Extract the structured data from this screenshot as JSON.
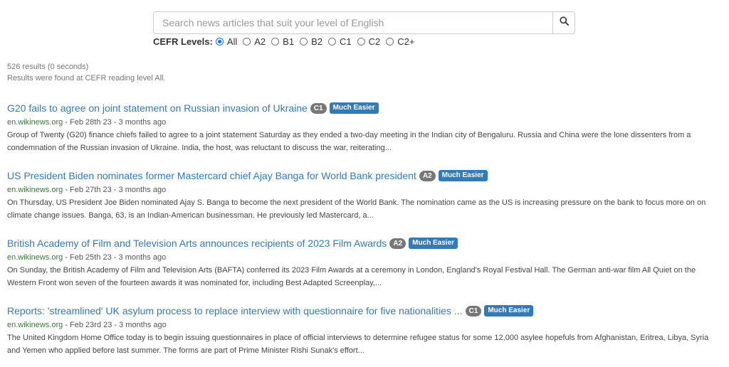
{
  "search": {
    "placeholder": "Search news articles that suit your level of English",
    "icon": "search-icon"
  },
  "cefr": {
    "label": "CEFR Levels:",
    "options": [
      {
        "label": "All",
        "checked": true
      },
      {
        "label": "A2",
        "checked": false
      },
      {
        "label": "B1",
        "checked": false
      },
      {
        "label": "B2",
        "checked": false
      },
      {
        "label": "C1",
        "checked": false
      },
      {
        "label": "C2",
        "checked": false
      },
      {
        "label": "C2+",
        "checked": false
      }
    ]
  },
  "meta": {
    "count": "526 results (0 seconds)",
    "level_note": "Results were found at CEFR reading level All."
  },
  "results": [
    {
      "title": "G20 fails to agree on joint statement on Russian invasion of Ukraine",
      "level": "C1",
      "ease": "Much Easier",
      "source": "en.wikinews.org",
      "date": " - Feb 28th 23 - 3 months ago",
      "snippet": "Group of Twenty (G20) finance chiefs failed to agree to a joint statement Saturday as they ended a two-day meeting in the Indian city of Bengaluru. Russia and China were the lone dissenters from a condemnation of the Russian invasion of Ukraine. India, the host, was reluctant to discuss the war, reiterating..."
    },
    {
      "title": "US President Biden nominates former Mastercard chief Ajay Banga for World Bank president",
      "level": "A2",
      "ease": "Much Easier",
      "source": "en.wikinews.org",
      "date": " - Feb 27th 23 - 3 months ago",
      "snippet": "On Thursday, US President Joe Biden nominated Ajay S. Banga to become the next president of the World Bank. The nomination came as the US is increasing pressure on the bank to focus more on on climate change issues. Banga, 63, is an Indian-American businessman. He previously led Mastercard, a..."
    },
    {
      "title": "British Academy of Film and Television Arts announces recipients of 2023 Film Awards",
      "level": "A2",
      "ease": "Much Easier",
      "source": "en.wikinews.org",
      "date": " - Feb 25th 23 - 3 months ago",
      "snippet": "On Sunday, the British Academy of Film and Television Arts (BAFTA) conferred its 2023 Film Awards at a ceremony in London, England's Royal Festival Hall. The German anti-war film All Quiet on the Western Front won seven of the fourteen awards it was nominated for, including Best Adapted Screenplay,..."
    },
    {
      "title": "Reports: 'streamlined' UK asylum process to replace interview with questionnaire for five nationalities ...",
      "level": "C1",
      "ease": "Much Easier",
      "source": "en.wikinews.org",
      "date": " - Feb 23rd 23 - 3 months ago",
      "snippet": "The United Kingdom Home Office today is to begin issuing questionnaires in place of official interviews to determine refugee status for some 12,000 asylee hopefuls from Afghanistan, Eritrea, Libya, Syria and Yemen who applied before last summer. The forms are part of Prime Minister Rishi Sunak's effort..."
    }
  ]
}
